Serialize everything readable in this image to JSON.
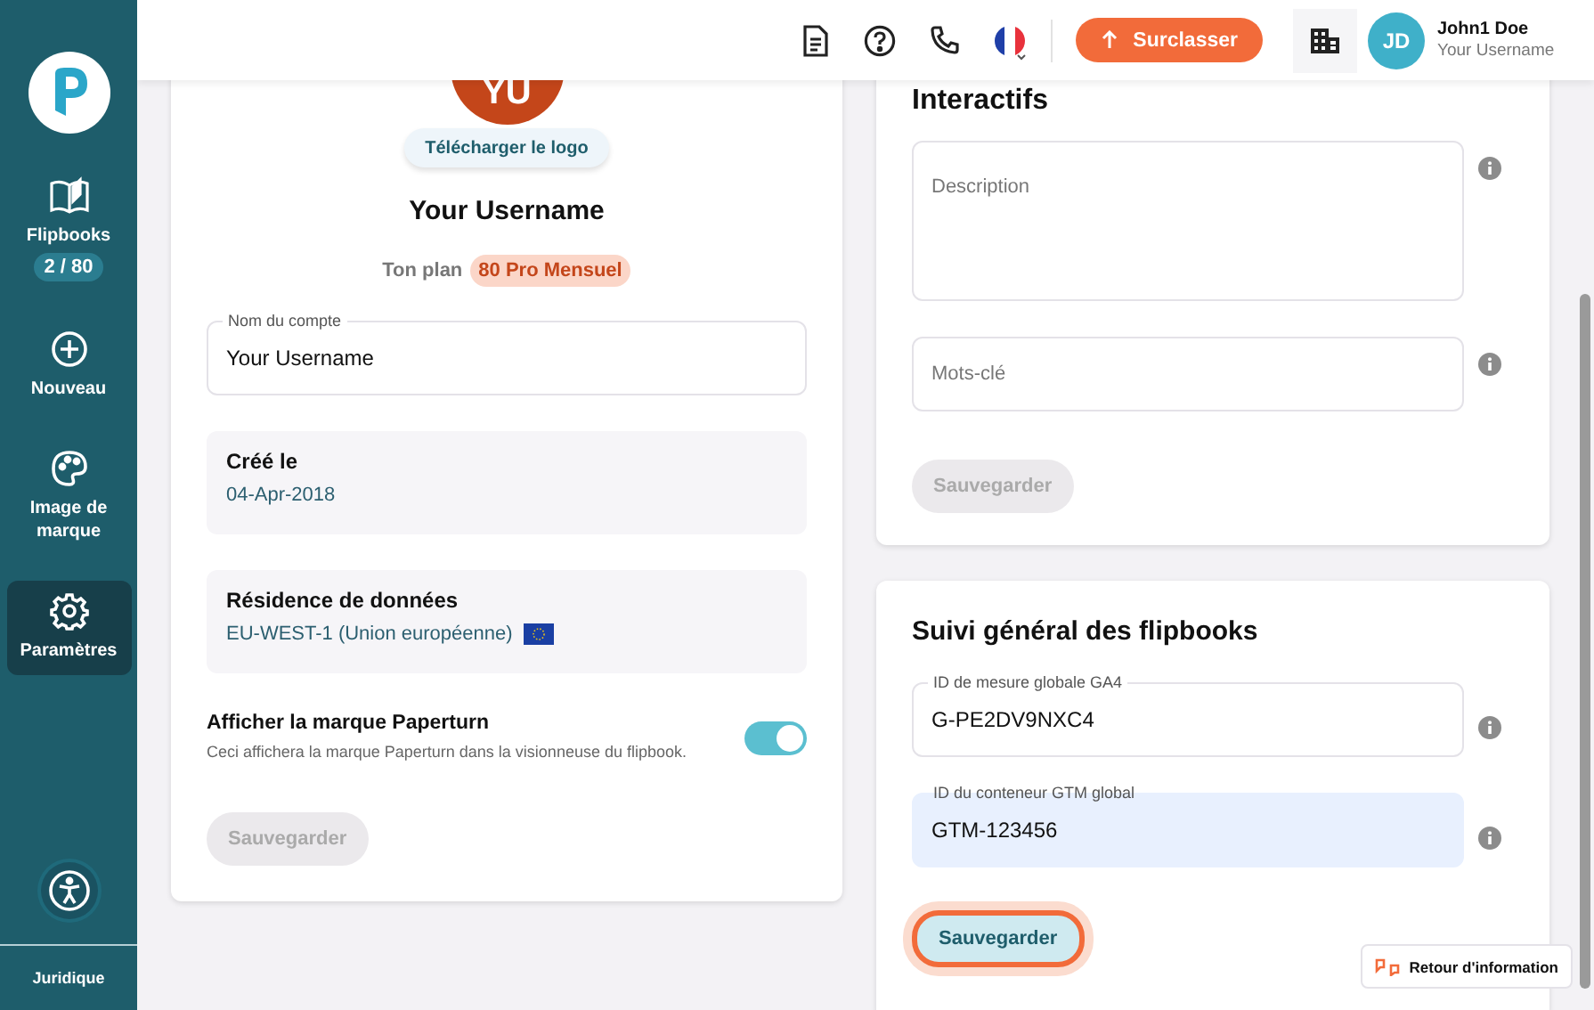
{
  "sidebar": {
    "items": [
      {
        "kind": "book",
        "label": "Flipbooks",
        "badge": "2 / 80",
        "selected": false
      },
      {
        "kind": "plus",
        "label": "Nouveau",
        "selected": false
      },
      {
        "kind": "palette",
        "label": "Image de marque",
        "selected": false
      },
      {
        "kind": "gear",
        "label": "Paramètres",
        "selected": true
      }
    ],
    "footer_link": "Juridique"
  },
  "header": {
    "upgrade_button": "Surclasser",
    "user": {
      "initials": "JD",
      "name": "John1 Doe",
      "username": "Your Username"
    }
  },
  "profile_card": {
    "avatar_initials": "YU",
    "upload_button": "Télécharger le logo",
    "username": "Your Username",
    "plan_label": "Ton plan",
    "plan_badge": "80 Pro Mensuel",
    "account_field": {
      "label": "Nom du compte",
      "value": "Your Username"
    },
    "created": {
      "label": "Créé le",
      "value": "04-Apr-2018"
    },
    "residence": {
      "label": "Résidence de données",
      "value": "EU-WEST-1 (Union européenne)"
    },
    "branding": {
      "title": "Afficher la marque Paperturn",
      "description": "Ceci affichera la marque Paperturn dans la visionneuse du flipbook.",
      "on": true
    },
    "save_button": {
      "label": "Sauvegarder",
      "disabled": true
    }
  },
  "interactive_card": {
    "heading": "Interactifs",
    "fields": [
      {
        "kind": "textarea",
        "placeholder": "Description"
      },
      {
        "kind": "input",
        "placeholder": "Mots-clé"
      }
    ],
    "save_button": {
      "label": "Sauvegarder",
      "disabled": true
    }
  },
  "tracking_card": {
    "heading": "Suivi général des flipbooks",
    "fields": [
      {
        "label": "ID de mesure globale GA4",
        "value": "G-PE2DV9NXC4",
        "highlighted": false
      },
      {
        "label": "ID du conteneur GTM global",
        "value": "GTM-123456",
        "highlighted": true
      }
    ],
    "save_button": {
      "label": "Sauvegarder",
      "disabled": false,
      "focused": true
    }
  },
  "feedback_button": "Retour d'information"
}
